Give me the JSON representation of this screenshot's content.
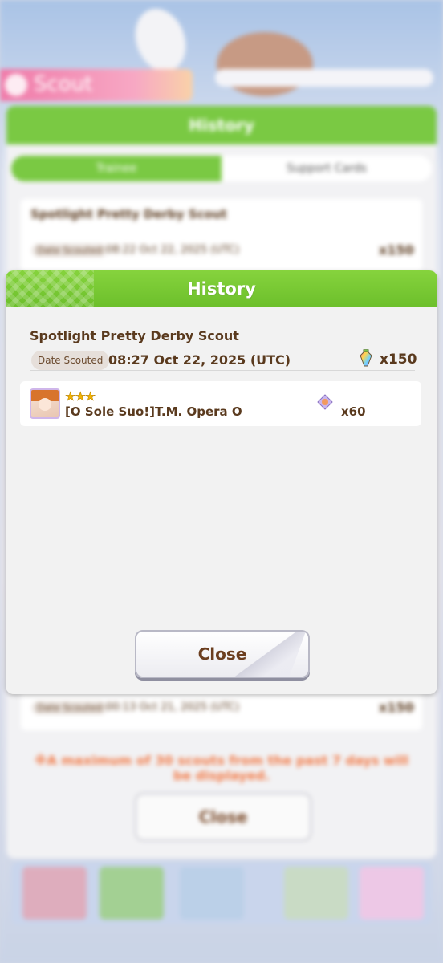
{
  "background": {
    "scout_tab_label": "Scout",
    "panel_title": "History",
    "tabs": [
      "Trainee",
      "Support Cards"
    ],
    "entries": [
      {
        "title": "Spotlight Pretty Derby Scout",
        "date_label": "Date Scouted",
        "date": "08:22 Oct 22, 2025 (UTC)",
        "cost": "x150"
      },
      {
        "title": "",
        "date_label": "Date Scouted",
        "date": "00:13 Oct 21, 2025 (UTC)",
        "cost": "x150"
      }
    ],
    "note": "※A maximum of 30 scouts from the past 7 days will be displayed.",
    "close_label": "Close"
  },
  "modal": {
    "title": "History",
    "scout_name": "Spotlight Pretty Derby Scout",
    "date_label": "Date Scouted",
    "date": "08:27 Oct 22, 2025 (UTC)",
    "cost": "x150",
    "cost_icon": "carat-ticket-icon",
    "result": {
      "rarity": "★★★",
      "name": "[O Sole Suo!]T.M. Opera O",
      "piece_icon": "piece-icon",
      "piece_count": "x60"
    },
    "close_label": "Close"
  },
  "colors": {
    "header_green": "#7ac943",
    "text_brown": "#5a3a1e",
    "note_orange": "#f27a47",
    "star_gold": "#f4b400"
  }
}
